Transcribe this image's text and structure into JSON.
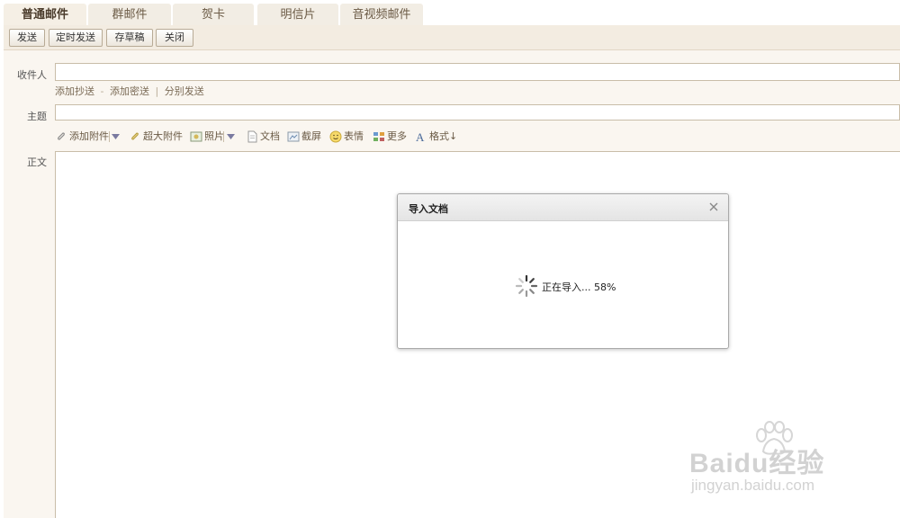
{
  "tabs": [
    {
      "label": "普通邮件",
      "active": true
    },
    {
      "label": "群邮件",
      "active": false
    },
    {
      "label": "贺卡",
      "active": false
    },
    {
      "label": "明信片",
      "active": false
    },
    {
      "label": "音视频邮件",
      "active": false
    }
  ],
  "toolbar": {
    "send": "发送",
    "scheduled_send": "定时发送",
    "save_draft": "存草稿",
    "close": "关闭"
  },
  "compose": {
    "to_label": "收件人",
    "to_value": "",
    "cc_links": {
      "add_cc": "添加抄送",
      "dash": "-",
      "add_bcc": "添加密送",
      "sep": "|",
      "separate_send": "分别发送"
    },
    "subject_label": "主题",
    "subject_value": "",
    "body_label": "正文"
  },
  "editor_toolbar": {
    "add_attachment": "添加附件",
    "large_attachment": "超大附件",
    "photo": "照片",
    "document": "文档",
    "screenshot": "截屏",
    "emoji": "表情",
    "more": "更多",
    "format": "格式↓"
  },
  "dialog": {
    "title": "导入文档",
    "progress_text": "正在导入... 58%",
    "progress": 0.58
  },
  "watermark": {
    "brand": "Baidu经验",
    "url": "jingyan.baidu.com"
  },
  "colors": {
    "accent": "#f3ece1",
    "panel": "#faf6f0",
    "border": "#c9bda9",
    "link": "#7a6a55"
  }
}
